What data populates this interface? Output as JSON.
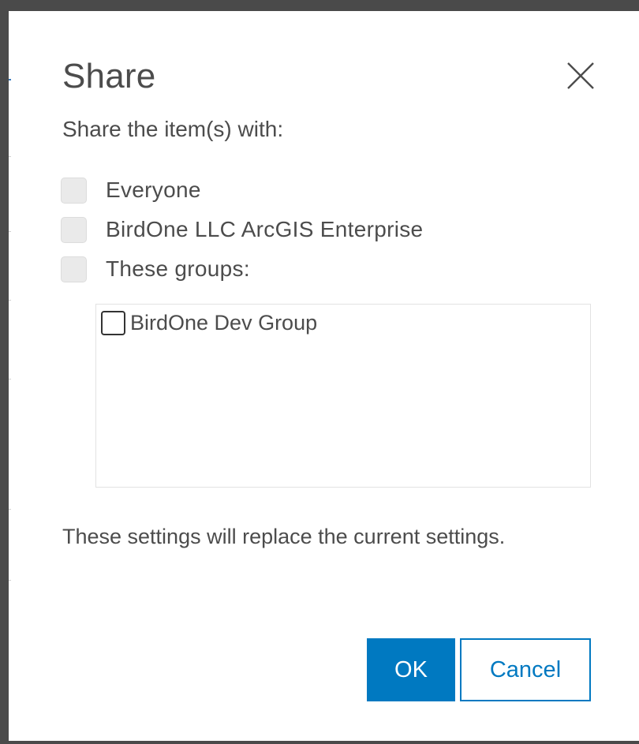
{
  "dialog": {
    "title": "Share",
    "close_icon": "close-icon",
    "intro": "Share the item(s) with:",
    "options": [
      {
        "label": "Everyone",
        "checked": false
      },
      {
        "label": "BirdOne LLC ArcGIS Enterprise",
        "checked": false
      },
      {
        "label": "These groups:",
        "checked": false
      }
    ],
    "groups": [
      {
        "label": "BirdOne Dev Group",
        "checked": false
      }
    ],
    "note": "These settings will replace the current settings.",
    "buttons": {
      "ok_label": "OK",
      "cancel_label": "Cancel"
    }
  },
  "colors": {
    "accent": "#0079c1",
    "text": "#4c4c4c",
    "checkbox_disabled_fill": "#eaeaea",
    "backdrop": "#4a4a4a"
  }
}
